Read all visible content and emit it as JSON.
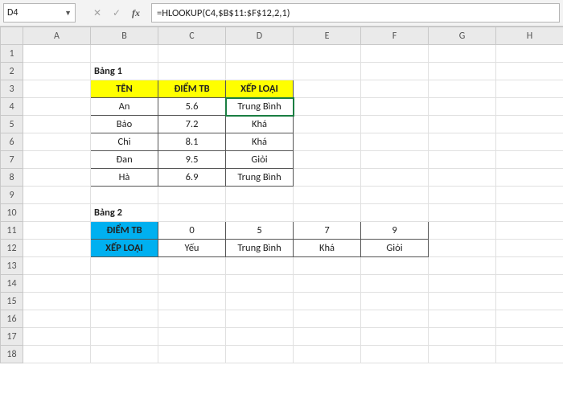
{
  "active_cell_ref": "D4",
  "formula": "=HLOOKUP(C4,$B$11:$F$12,2,1)",
  "columns": [
    "A",
    "B",
    "C",
    "D",
    "E",
    "F",
    "G",
    "H"
  ],
  "rows": [
    "1",
    "2",
    "3",
    "4",
    "5",
    "6",
    "7",
    "8",
    "9",
    "10",
    "11",
    "12",
    "13",
    "14",
    "15",
    "16",
    "17",
    "18"
  ],
  "b2": "Bảng 1",
  "b3": "TÊN",
  "c3": "ĐIỂM TB",
  "d3": "XẾP LOẠI",
  "b4": "An",
  "c4": "5.6",
  "d4": "Trung Bình",
  "b5": "Bảo",
  "c5": "7.2",
  "d5": "Khá",
  "b6": "Chi",
  "c6": "8.1",
  "d6": "Khá",
  "b7": "Đan",
  "c7": "9.5",
  "d7": "Giỏi",
  "b8": "Hà",
  "c8": "6.9",
  "d8": "Trung Bình",
  "b10": "Bảng 2",
  "b11": "ĐIỂM TB",
  "c11": "0",
  "d11": "5",
  "e11": "7",
  "f11": "9",
  "b12": "XẾP LOẠI",
  "c12": "Yếu",
  "d12": "Trung Bình",
  "e12": "Khá",
  "f12": "Giỏi"
}
